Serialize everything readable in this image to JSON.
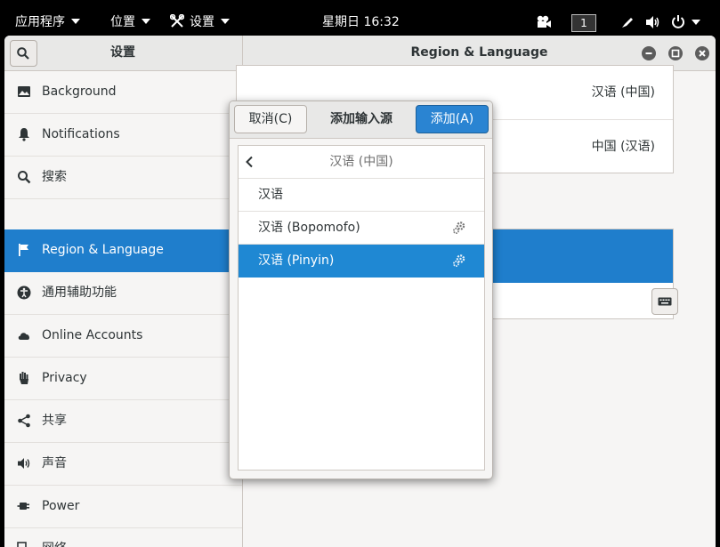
{
  "topbar": {
    "apps": "应用程序",
    "places": "位置",
    "settings": "设置",
    "clock": "星期日 16:32",
    "workspace": "1"
  },
  "headerbar": {
    "sidebar_title": "设置",
    "panel_title": "Region & Language"
  },
  "sidebar": {
    "items": [
      {
        "label": "Background",
        "icon": "background-icon"
      },
      {
        "label": "Notifications",
        "icon": "bell-icon"
      },
      {
        "label": "搜索",
        "icon": "search-icon"
      },
      {
        "label": "Region & Language",
        "icon": "flag-icon",
        "selected": true
      },
      {
        "label": "通用辅助功能",
        "icon": "accessibility-icon"
      },
      {
        "label": "Online Accounts",
        "icon": "cloud-icon"
      },
      {
        "label": "Privacy",
        "icon": "hand-icon"
      },
      {
        "label": "共享",
        "icon": "share-icon"
      },
      {
        "label": "声音",
        "icon": "speaker-icon"
      },
      {
        "label": "Power",
        "icon": "power-plug-icon"
      },
      {
        "label": "网络",
        "icon": "network-icon"
      }
    ]
  },
  "region": {
    "language_value": "汉语 (中国)",
    "formats_value": "中国 (汉语)"
  },
  "dialog": {
    "cancel_label": "取消(C)",
    "title": "添加输入源",
    "add_label": "添加(A)",
    "back_header": "汉语 (中国)",
    "items": [
      {
        "label": "汉语",
        "has_settings": false
      },
      {
        "label": "汉语 (Bopomofo)",
        "has_settings": true
      },
      {
        "label": "汉语 (Pinyin)",
        "has_settings": true,
        "selected": true
      }
    ]
  },
  "colors": {
    "accent": "#1f7ecc",
    "selected_row": "#1f88d3"
  }
}
